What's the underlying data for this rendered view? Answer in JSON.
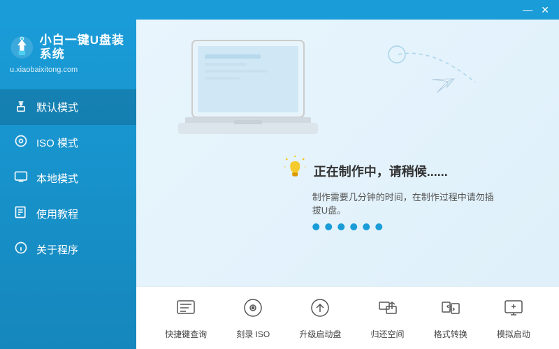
{
  "titleBar": {
    "minimizeLabel": "—",
    "closeLabel": "✕"
  },
  "sidebar": {
    "title": "小白一键U盘装系统",
    "url": "u.xiaobaixitong.com",
    "navItems": [
      {
        "id": "default-mode",
        "label": "默认模式",
        "icon": "usb",
        "active": true
      },
      {
        "id": "iso-mode",
        "label": "ISO 模式",
        "icon": "disc"
      },
      {
        "id": "local-mode",
        "label": "本地模式",
        "icon": "monitor"
      },
      {
        "id": "tutorial",
        "label": "使用教程",
        "icon": "book"
      },
      {
        "id": "about",
        "label": "关于程序",
        "icon": "info"
      }
    ]
  },
  "mainArea": {
    "statusMain": "正在制作中，请稍候......",
    "statusSub": "制作需要几分钟的时间，在制作过程中请勿插拔U盘。",
    "dotsCount": 6
  },
  "toolbar": {
    "tools": [
      {
        "id": "shortcut-query",
        "label": "快捷键查询",
        "icon": "shortcut"
      },
      {
        "id": "burn-iso",
        "label": "刻录 ISO",
        "icon": "disc"
      },
      {
        "id": "upgrade-boot",
        "label": "升级启动盘",
        "icon": "upgrade"
      },
      {
        "id": "restore-space",
        "label": "归还空间",
        "icon": "restore"
      },
      {
        "id": "format-convert",
        "label": "格式转换",
        "icon": "format"
      },
      {
        "id": "simulate-boot",
        "label": "模拟启动",
        "icon": "monitor"
      }
    ]
  }
}
